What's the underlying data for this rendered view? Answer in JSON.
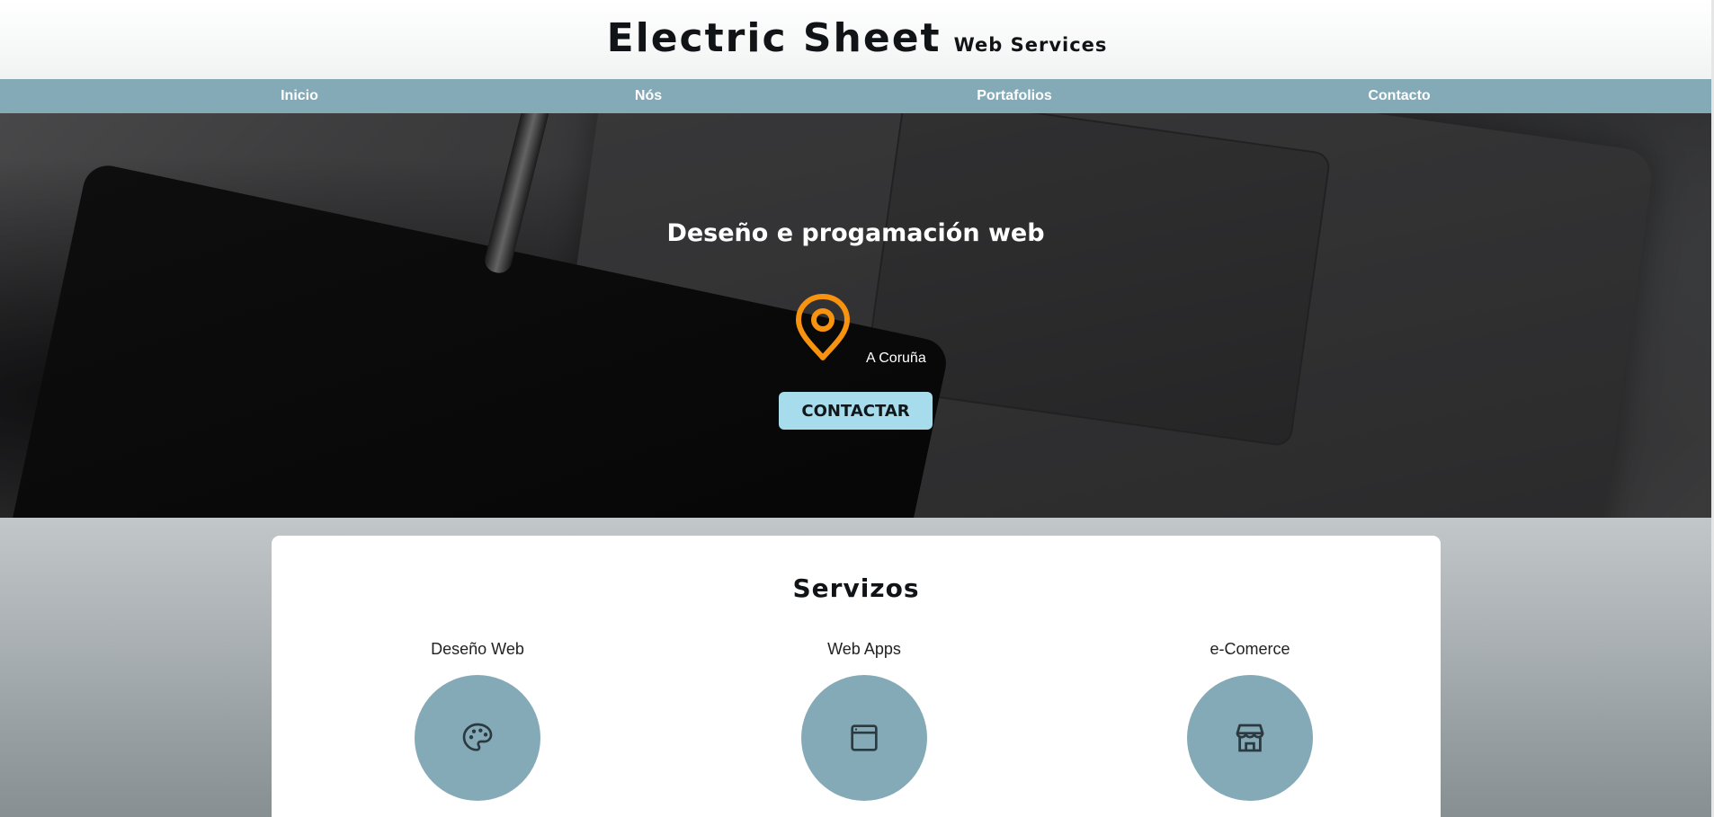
{
  "header": {
    "title": "Electric Sheet",
    "subtitle": "Web Services"
  },
  "nav": {
    "items": [
      "Inicio",
      "Nós",
      "Portafolios",
      "Contacto"
    ]
  },
  "hero": {
    "title": "Deseño e progamación web",
    "location": "A Coruña",
    "cta_label": "CONTACTAR",
    "icon": "map-pin-icon"
  },
  "services": {
    "title": "Servizos",
    "items": [
      {
        "name": "Deseño Web",
        "icon": "palette-icon"
      },
      {
        "name": "Web Apps",
        "icon": "browser-window-icon"
      },
      {
        "name": "e-Comerce",
        "icon": "storefront-icon"
      }
    ]
  },
  "colors": {
    "nav_bg": "#85aab7",
    "accent_orange": "#f7930e",
    "cta_bg": "#a6dcec",
    "service_circle": "#85aab7"
  }
}
